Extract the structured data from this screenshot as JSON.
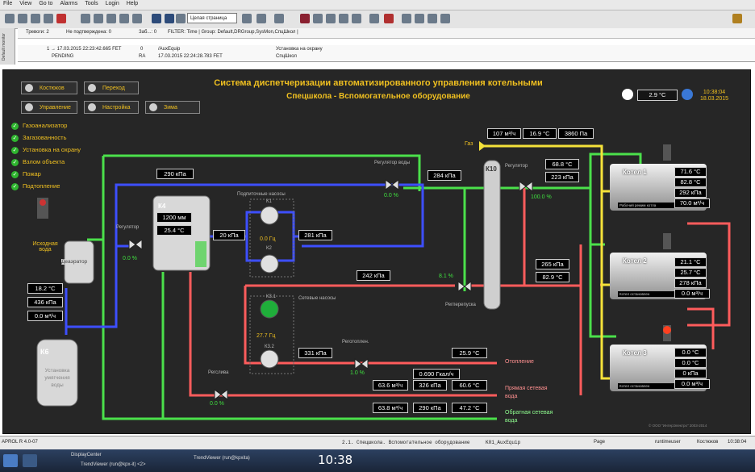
{
  "menu": [
    "File",
    "View",
    "Go to",
    "Alarms",
    "Tools",
    "Login",
    "Help"
  ],
  "toolbar": {
    "page_select": "Целая страница"
  },
  "filter_bar": {
    "alarms": "Тревоги: 2",
    "unacknowledged": "Не подтверждена: 0",
    "blocked": "Заб...: 0",
    "filter": "FILTER: Time | Group: Default,DRGroup,SysMon,СпцШкол |"
  },
  "side_tab": "Default monitor",
  "alarm_row": {
    "time1": "1 → 17.03.2015 22:23:42.665 FET",
    "status1": "PENDING",
    "code": "0",
    "code2": "RA",
    "time2": "17.03.2015 22:24:28.783 FET",
    "tag": "/AuxEquip",
    "msg": "Установка на охрану",
    "source": "СпцШкол"
  },
  "scada": {
    "title": "Система диспетчеризации автоматизированного управления котельными",
    "subtitle": "Спецшкола - Вспомогательное оборудование",
    "outdoor_temp": "2.9 °C",
    "time": "10:38:04",
    "date": "18.03.2015",
    "nav": [
      {
        "label": "Костюков",
        "icon": "person-icon"
      },
      {
        "label": "Переход",
        "icon": "home-icon"
      },
      {
        "label": "Управление",
        "icon": "gear-icon"
      },
      {
        "label": "Настройка",
        "icon": "wrench-icon"
      },
      {
        "label": "Зима",
        "icon": "snowflake-icon"
      }
    ],
    "status_list": [
      "Газоанализатор",
      "Загазованность",
      "Установка на охрану",
      "Взлом объекта",
      "Пожар",
      "Подтопление"
    ],
    "source_water": {
      "label1": "Исходная",
      "label2": "вода",
      "temp": "18.2 °C",
      "pressure": "436 кПа",
      "flow": "0.0 м³/ч"
    },
    "k6": {
      "name": "К6",
      "desc": [
        "Установка",
        "умягчения",
        "воды"
      ]
    },
    "deaerator": "Деаэратор",
    "reg_valve_left": {
      "label": "Регулятор",
      "pct": "0.0 %"
    },
    "k4": {
      "name": "К4",
      "level": "1200 мм",
      "temp": "25.4 °C"
    },
    "p290": "290 кПа",
    "p20": "20 кПа",
    "p281": "281 кПа",
    "make_up_pumps": {
      "label": "Подпиточные насосы",
      "k1": "К1",
      "freq": "0.0 Гц",
      "k2": "К2"
    },
    "reg_water": {
      "label": "Регулятор воды",
      "pct": "0.0 %"
    },
    "p284": "284 кПа",
    "k10": "К10",
    "gas": {
      "label": "Газ",
      "flow": "107 м³/ч",
      "temp": "16.9 °C",
      "pressure": "3860 Па"
    },
    "reg_right": {
      "label": "Регулятор",
      "temp": "68.8 °C",
      "pressure": "223 кПа",
      "pct": "100.0 %"
    },
    "p242": "242 кПа",
    "bypass": {
      "label": "Регперепуска",
      "pct": "8.1 %"
    },
    "p265": "265 кПа",
    "t829": "82.9 °C",
    "network_pumps": {
      "label": "Сетевые насосы",
      "k31": "К3.1",
      "freq": "27.7 Гц",
      "k32": "К3.2"
    },
    "reg_heat": {
      "label": "Реготоплен.",
      "pct": "1.0 %"
    },
    "reg_drain": {
      "label": "Регслива",
      "pct": "0.0 %"
    },
    "p331": "331 кПа",
    "heating": {
      "temp": "25.9 °C",
      "label": "Отопление"
    },
    "supply": {
      "power": "0.690 Гкал/ч",
      "flow": "63.6 м³/ч",
      "pressure": "326 кПа",
      "temp": "60.6 °C",
      "label": [
        "Прямая сетевая",
        "вода"
      ]
    },
    "return": {
      "flow": "63.8 м³/ч",
      "pressure": "290 кПа",
      "temp": "47.2 °C",
      "label": [
        "Обратная сетевая",
        "вода"
      ]
    },
    "boilers": [
      {
        "name": "Котел 1",
        "vals": [
          "71.6 °C",
          "82.8 °C",
          "292 кПа",
          "70.0 м³/ч"
        ],
        "status": "Рабочий режим котла"
      },
      {
        "name": "Котел 2",
        "vals": [
          "21.1 °C",
          "25.7 °C",
          "278 кПа",
          "0.0 м³/ч"
        ],
        "status": "Котел остановлен"
      },
      {
        "name": "Котел 3",
        "vals": [
          "0.0 °C",
          "0.0 °C",
          "0 кПа",
          "0.0 м³/ч"
        ],
        "status": "Котел остановлен"
      }
    ],
    "copyright": "© ООО \"ИнтерЭлектро\" 2003-2014"
  },
  "status_bar": {
    "left": "APROL R 4.0-07",
    "path": "2.1. Спецшкола. Вспомогательное оборудование",
    "page": "K01_AuxEquip",
    "page_btn": "Page",
    "user": "runtimeuser",
    "host": "Костюков",
    "time": "10:38:04"
  },
  "taskbar": {
    "item1": "DisplayCenter",
    "item2": "TrendViewer (run@kpxita)",
    "item3": "TrendViewer (run@kpx-it) <2>",
    "clock": "10:38"
  }
}
